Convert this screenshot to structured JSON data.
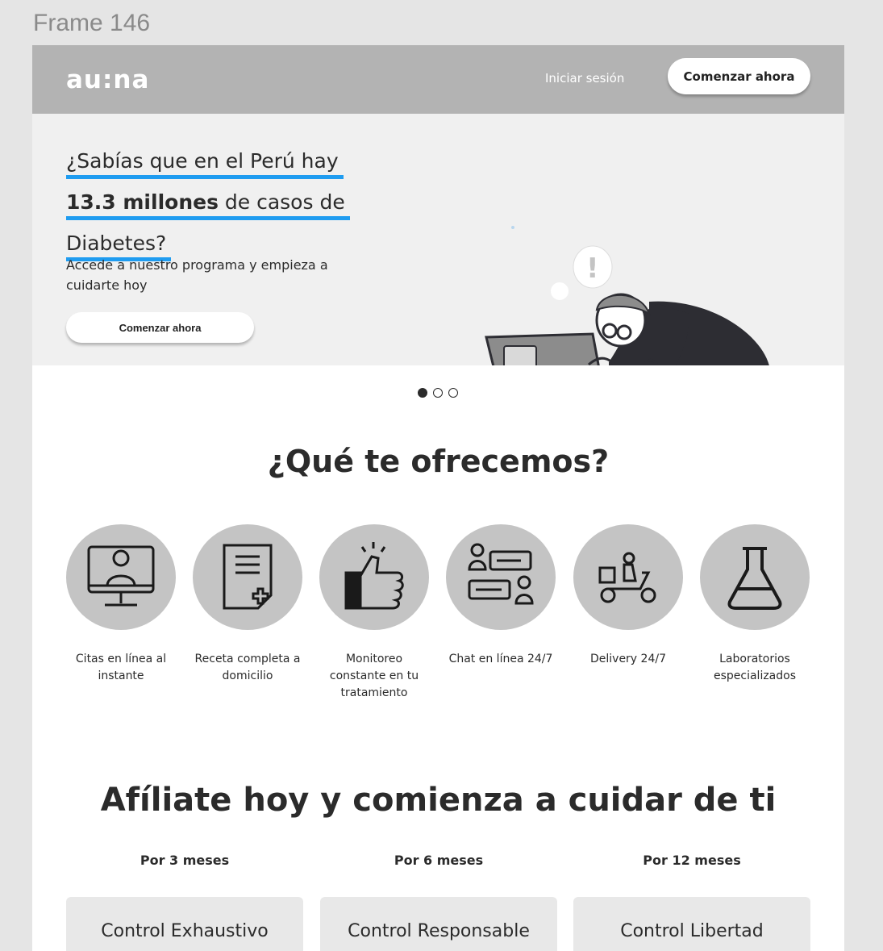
{
  "frame_label": "Frame 146",
  "header": {
    "logo": "au:na",
    "login_label": "Iniciar sesión",
    "cta_label": "Comenzar ahora"
  },
  "hero": {
    "title_line1": "¿Sabías que en el Perú hay",
    "title_bold": "13.3 millones",
    "title_line2_rest": " de casos de",
    "title_line3": "Diabetes?",
    "subtitle": "Accede a nuestro programa y empieza a cuidarte hoy",
    "cta_label": "Comenzar ahora"
  },
  "carousel": {
    "count": 3,
    "active": 0
  },
  "offers": {
    "title": "¿Qué te ofrecemos?",
    "items": [
      {
        "icon": "doctor-monitor-icon",
        "label": "Citas en línea al instante"
      },
      {
        "icon": "prescription-icon",
        "label": "Receta completa a domicilio"
      },
      {
        "icon": "thumbs-up-icon",
        "label": "Monitoreo constante en tu tratamiento"
      },
      {
        "icon": "chat-icon",
        "label": "Chat en línea 24/7"
      },
      {
        "icon": "delivery-scooter-icon",
        "label": "Delivery 24/7"
      },
      {
        "icon": "flask-icon",
        "label": "Laboratorios especializados"
      }
    ]
  },
  "plans": {
    "title": "Afíliate hoy y comienza a cuidar de ti",
    "items": [
      {
        "period": "Por 3 meses",
        "name": "Control Exhaustivo"
      },
      {
        "period": "Por 6 meses",
        "name": "Control Responsable"
      },
      {
        "period": "Por 12 meses",
        "name": "Control Libertad"
      }
    ]
  },
  "colors": {
    "accent": "#1f9cf0",
    "header_bg": "#b3b3b3",
    "hero_bg": "#f0f0f0",
    "icon_circle": "#c4c4c4"
  }
}
